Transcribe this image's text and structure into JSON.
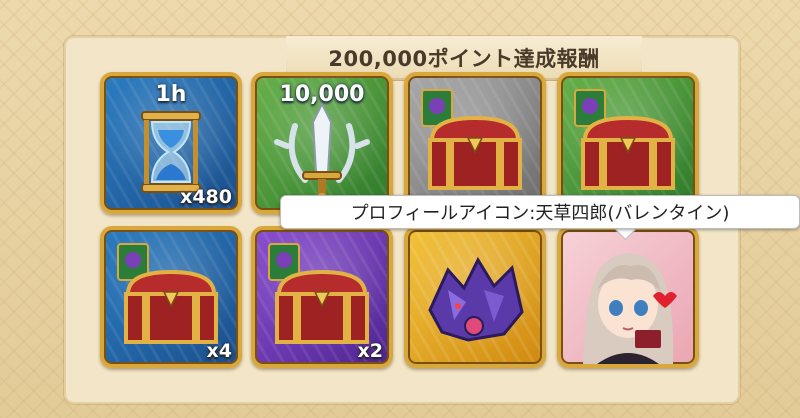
{
  "title": "200,000ポイント達成報酬",
  "rewards": [
    {
      "name": "hourglass",
      "amount": "1h",
      "qty": "x480",
      "bg": "blue"
    },
    {
      "name": "sword-emblem",
      "amount": "10,000",
      "qty": "",
      "bg": "green"
    },
    {
      "name": "treasure-chest",
      "amount": "",
      "qty": "",
      "bg": "gray"
    },
    {
      "name": "treasure-chest",
      "amount": "",
      "qty": "",
      "bg": "green"
    },
    {
      "name": "treasure-chest",
      "amount": "",
      "qty": "x4",
      "bg": "blue"
    },
    {
      "name": "treasure-chest",
      "amount": "",
      "qty": "x2",
      "bg": "purple"
    },
    {
      "name": "crystal-dragon",
      "amount": "",
      "qty": "",
      "bg": "gold"
    },
    {
      "name": "profile-portrait",
      "amount": "",
      "qty": "",
      "bg": "pink"
    }
  ],
  "tooltip": {
    "text": "プロフィールアイコン:天草四郎(バレンタイン)"
  },
  "colors": {
    "frame": "#d9a83c",
    "panel": "#f3e6c8",
    "title_text": "#4a3a2a"
  }
}
